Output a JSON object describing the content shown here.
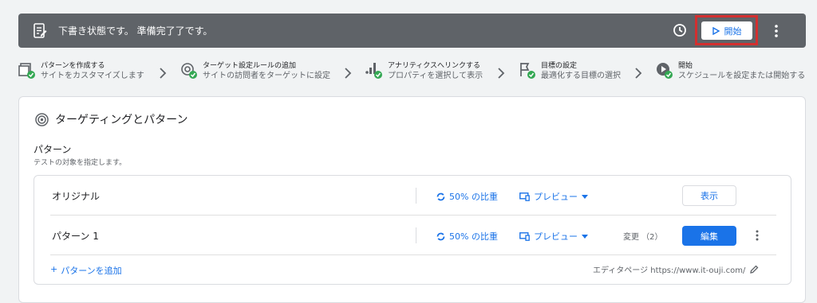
{
  "topbar": {
    "status": "下書き状態です。 準備完了了です。",
    "start_label": "開始",
    "icons": [
      "document-icon",
      "clock-icon",
      "more-vert-icon"
    ]
  },
  "steps": [
    {
      "title": "パターンを作成する",
      "subtitle": "サイトをカスタマイズします",
      "icon": "variant-icon"
    },
    {
      "title": "ターゲット設定ルールの追加",
      "subtitle": "サイトの訪問者をターゲットに設定",
      "icon": "target-icon"
    },
    {
      "title": "アナリティクスへリンクする",
      "subtitle": "プロパティを選択して表示",
      "icon": "analytics-icon"
    },
    {
      "title": "目標の設定",
      "subtitle": "最適化する目標の選択",
      "icon": "flag-icon"
    },
    {
      "title": "開始",
      "subtitle": "スケジュールを設定または開始する",
      "icon": "play-icon"
    }
  ],
  "section": {
    "title": "ターゲティングとパターン",
    "label": "パターン",
    "description": "テストの対象を指定します。"
  },
  "variants": [
    {
      "name": "オリジナル",
      "weight": "50% の比重",
      "preview": "プレビュー",
      "changes": "",
      "action": "表示"
    },
    {
      "name": "パターン 1",
      "weight": "50% の比重",
      "preview": "プレビュー",
      "changes": "変更 （2）",
      "action": "編集"
    }
  ],
  "add_variant": "パターンを追加",
  "add_plus": "+",
  "editor_page": "エディタページ https://www.it-ouji.com/",
  "colors": {
    "accent": "#1a73e8",
    "topbar": "#5f6368",
    "check": "#34a853",
    "highlight": "#d32f2f"
  }
}
